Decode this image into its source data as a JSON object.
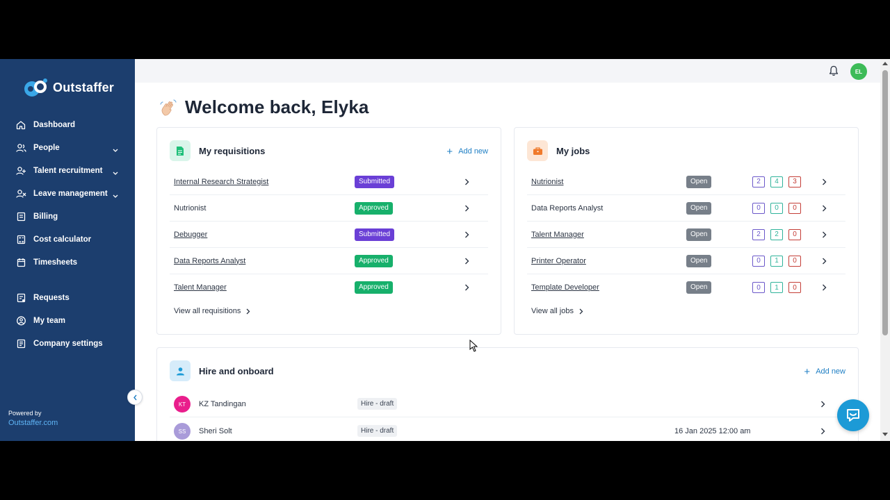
{
  "brand": {
    "name": "Outstaffer",
    "powered_by": "Powered by",
    "powered_link": "Outstaffer.com"
  },
  "sidebar": {
    "items": [
      {
        "label": "Dashboard",
        "icon": "home-icon"
      },
      {
        "label": "People",
        "icon": "people-icon",
        "expandable": true
      },
      {
        "label": "Talent recruitment",
        "icon": "recruitment-icon",
        "expandable": true
      },
      {
        "label": "Leave management",
        "icon": "leave-icon",
        "expandable": true
      },
      {
        "label": "Billing",
        "icon": "billing-icon"
      },
      {
        "label": "Cost calculator",
        "icon": "calculator-icon"
      },
      {
        "label": "Timesheets",
        "icon": "timesheet-icon"
      },
      {
        "label": "Requests",
        "icon": "requests-icon"
      },
      {
        "label": "My team",
        "icon": "team-icon"
      },
      {
        "label": "Company settings",
        "icon": "settings-icon"
      }
    ]
  },
  "topbar": {
    "avatar_initials": "EL"
  },
  "welcome": {
    "title": "Welcome back, Elyka"
  },
  "requisitions": {
    "title": "My requisitions",
    "add_new": "Add new",
    "rows": [
      {
        "name": "Internal Research Strategist",
        "status": "Submitted"
      },
      {
        "name": "Nutrionist",
        "status": "Approved"
      },
      {
        "name": "Debugger",
        "status": "Submitted"
      },
      {
        "name": "Data Reports Analyst",
        "status": "Approved"
      },
      {
        "name": "Talent Manager",
        "status": "Approved"
      }
    ],
    "view_all": "View all requisitions"
  },
  "jobs": {
    "title": "My jobs",
    "rows": [
      {
        "name": "Nutrionist",
        "status": "Open",
        "counts": [
          "2",
          "4",
          "3"
        ]
      },
      {
        "name": "Data Reports Analyst",
        "status": "Open",
        "counts": [
          "0",
          "0",
          "0"
        ]
      },
      {
        "name": "Talent Manager",
        "status": "Open",
        "counts": [
          "2",
          "2",
          "0"
        ]
      },
      {
        "name": "Printer Operator",
        "status": "Open",
        "counts": [
          "0",
          "1",
          "0"
        ]
      },
      {
        "name": "Template Developer",
        "status": "Open",
        "counts": [
          "0",
          "1",
          "0"
        ]
      }
    ],
    "view_all": "View all jobs"
  },
  "hire": {
    "title": "Hire and onboard",
    "add_new": "Add new",
    "rows": [
      {
        "initials": "KT",
        "name": "KZ Tandingan",
        "status": "Hire - draft",
        "date": "",
        "avatar_color": "#e91e8c"
      },
      {
        "initials": "SS",
        "name": "Sheri Solt",
        "status": "Hire - draft",
        "date": "16 Jan 2025 12:00 am",
        "avatar_color": "#a99bd9"
      }
    ]
  },
  "colors": {
    "sidebar": "#1c3e6e",
    "accent": "#1f7fc4",
    "submitted": "#6a3fd6",
    "approved": "#17b06b",
    "open": "#777f89"
  }
}
